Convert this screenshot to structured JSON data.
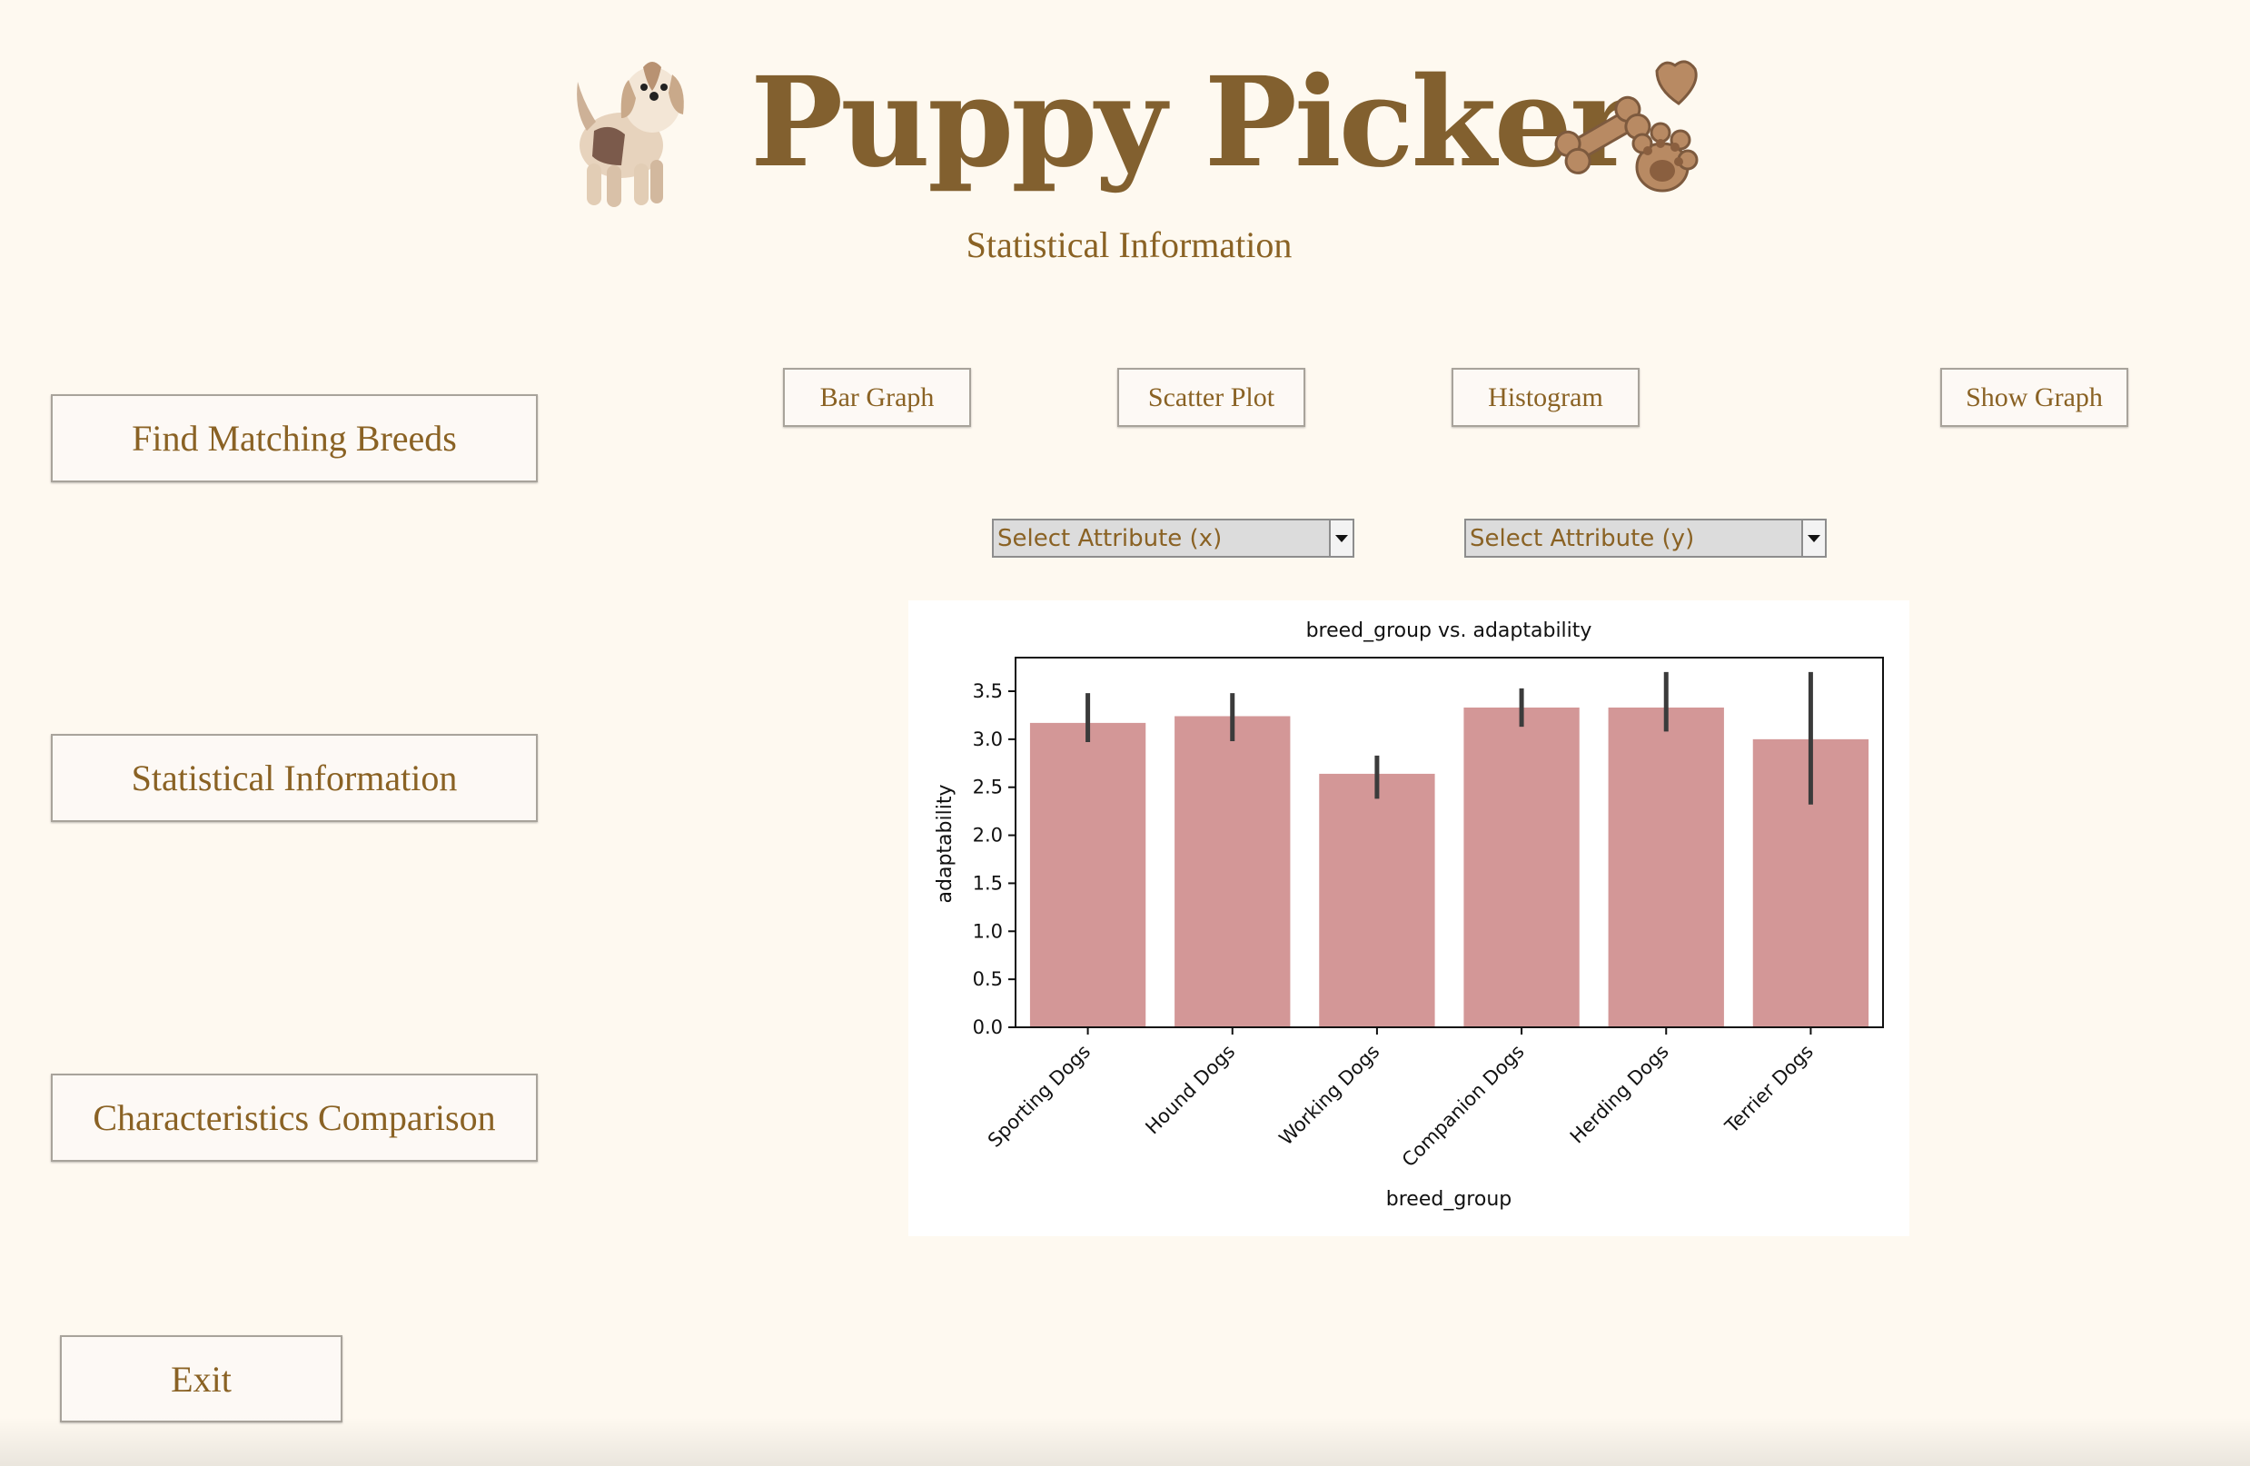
{
  "header": {
    "title": "Puppy Picker",
    "subtitle": "Statistical Information",
    "logo": "dog-illustration",
    "decoration": "treats-icon"
  },
  "sidebar": {
    "find_matching": "Find Matching Breeds",
    "statistical": "Statistical Information",
    "comparison": "Characteristics Comparison",
    "exit": "Exit"
  },
  "toolbar": {
    "bar_graph": "Bar Graph",
    "scatter_plot": "Scatter Plot",
    "histogram": "Histogram",
    "show_graph": "Show Graph"
  },
  "selects": {
    "x": "Select Attribute (x)",
    "y": "Select Attribute (y)"
  },
  "colors": {
    "background": "#fef9f0",
    "text_brown": "#8a6224",
    "title_brown": "#82602f",
    "bar_fill": "#d39797",
    "error_bar": "#3b3b3b"
  },
  "chart_data": {
    "type": "bar",
    "title": "breed_group vs. adaptability",
    "xlabel": "breed_group",
    "ylabel": "adaptability",
    "categories": [
      "Sporting Dogs",
      "Hound Dogs",
      "Working Dogs",
      "Companion Dogs",
      "Herding Dogs",
      "Terrier Dogs"
    ],
    "values": [
      3.17,
      3.24,
      2.64,
      3.33,
      3.33,
      3.0
    ],
    "error_low": [
      2.97,
      2.98,
      2.38,
      3.13,
      3.08,
      2.32
    ],
    "error_high": [
      3.48,
      3.48,
      2.83,
      3.53,
      3.7,
      3.7
    ],
    "yticks": [
      "0.0",
      "0.5",
      "1.0",
      "1.5",
      "2.0",
      "2.5",
      "3.0",
      "3.5"
    ],
    "ylim": [
      0,
      3.85
    ],
    "grid": false,
    "legend": "none"
  }
}
